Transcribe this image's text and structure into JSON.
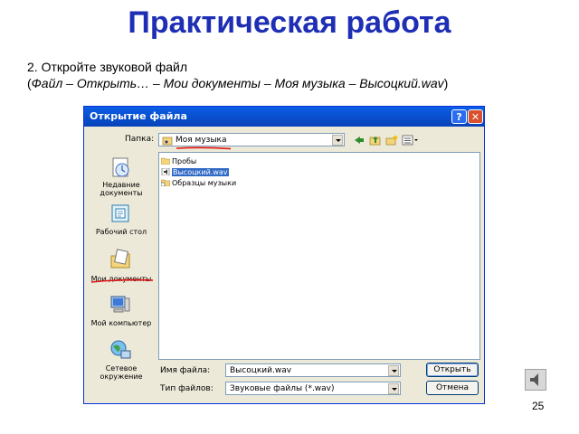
{
  "slide": {
    "title": "Практическая работа",
    "task_line1": "2. Откройте звуковой файл",
    "task_line2_open": "(",
    "task_line2_italic": "Файл – Открыть… – Мои документы – Моя музыка – Высоцкий.wav",
    "task_line2_close": ")",
    "page_number": "25"
  },
  "dialog": {
    "title": "Открытие файла",
    "help_label": "?",
    "close_label": "✕",
    "folder_label": "Папка:",
    "folder_value": "Моя музыка",
    "places": [
      {
        "label": "Недавние документы",
        "icon": "recent-documents-icon"
      },
      {
        "label": "Рабочий стол",
        "icon": "desktop-icon"
      },
      {
        "label": "Мои документы",
        "icon": "my-documents-icon"
      },
      {
        "label": "Мой компьютер",
        "icon": "my-computer-icon"
      },
      {
        "label": "Сетевое окружение",
        "icon": "network-icon"
      }
    ],
    "files": [
      {
        "name": "Пробы",
        "type": "folder"
      },
      {
        "name": "Высоцкий.wav",
        "type": "sound",
        "selected": true
      },
      {
        "name": "Образцы музыки",
        "type": "shortcut-folder"
      }
    ],
    "filename_label": "Имя файла:",
    "filename_value": "Высоцкий.wav",
    "filetype_label": "Тип файлов:",
    "filetype_value": "Звуковые файлы (*.wav)",
    "open_button": "Открыть",
    "cancel_button": "Отмена"
  },
  "colors": {
    "title": "#1f2fb5",
    "dialog_bg": "#ece9d8",
    "titlebar": "#0a5ee6",
    "selection": "#316ac5",
    "annotation": "#e01010"
  }
}
